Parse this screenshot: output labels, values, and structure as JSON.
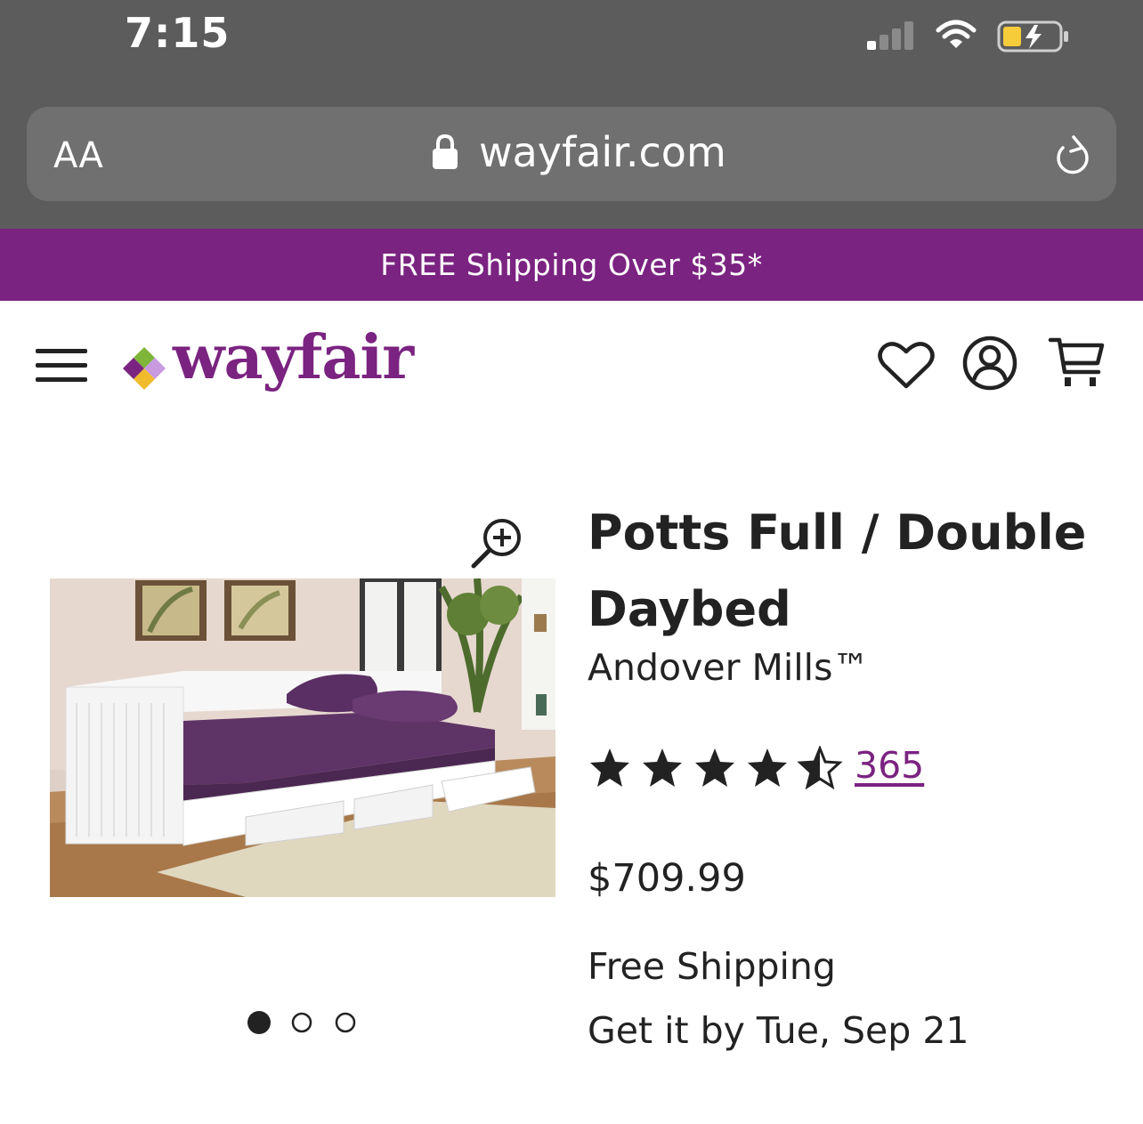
{
  "status_bar": {
    "time": "7:15"
  },
  "browser": {
    "text_size_label": "AA",
    "url": "wayfair.com"
  },
  "promo": {
    "text": "FREE Shipping Over $35*"
  },
  "header": {
    "logo_text": "wayfair",
    "brand_color": "#7b2381"
  },
  "product": {
    "title": "Potts Full / Double Daybed",
    "brand": "Andover Mills™",
    "rating": 4.5,
    "rating_max": 5,
    "review_count": "365",
    "price": "$709.99",
    "shipping": "Free Shipping",
    "delivery": "Get it by Tue, Sep 21",
    "image_count": 3,
    "image_index": 1
  },
  "icons": [
    "signal-icon",
    "wifi-icon",
    "battery-icon",
    "lock-icon",
    "reload-icon",
    "menu-icon",
    "heart-icon",
    "account-icon",
    "cart-icon",
    "zoom-icon",
    "star-icon"
  ]
}
